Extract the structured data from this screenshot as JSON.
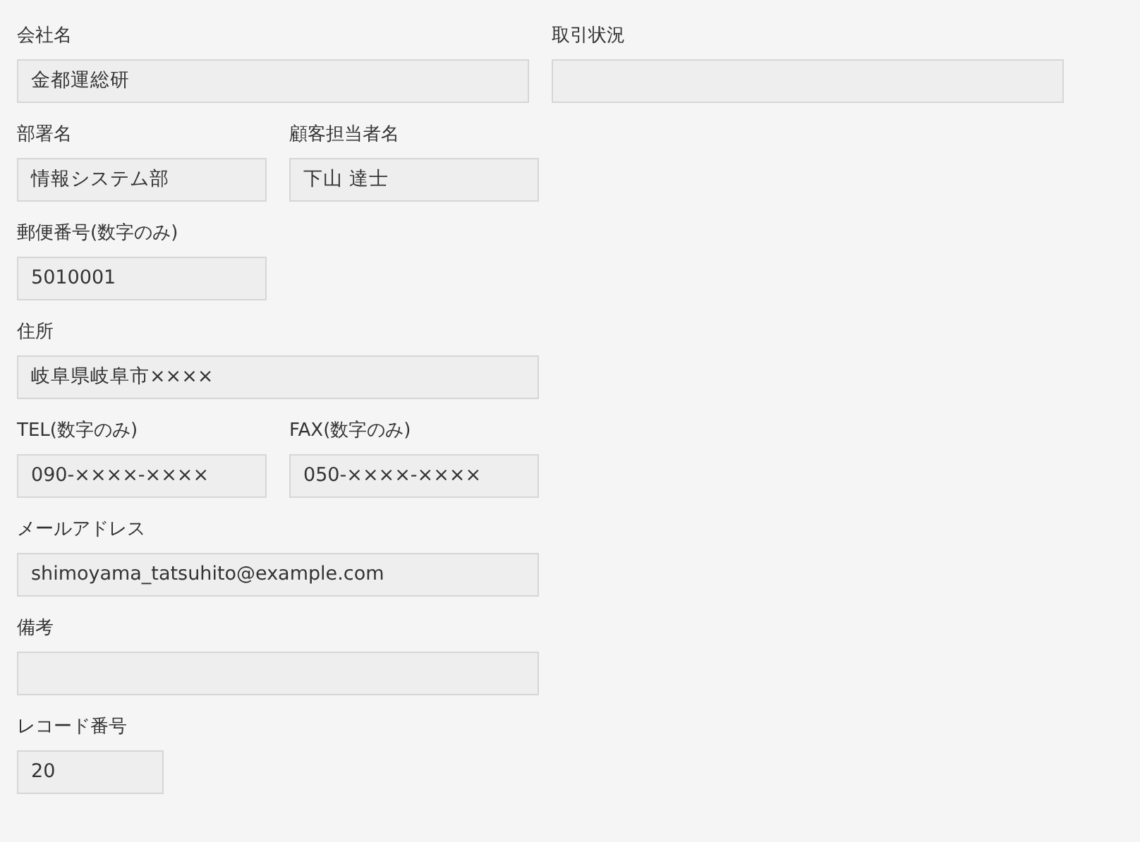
{
  "rows": [
    [
      {
        "label": "会社名",
        "value": "金都運総研",
        "kind": "wide"
      },
      {
        "label": "取引状況",
        "kind": "wide"
      }
    ],
    [
      {
        "label": "部署名",
        "value": "情報システム部",
        "kind": "half"
      },
      {
        "label": "顧客担当者名",
        "value": "下山 達士",
        "kind": "half"
      }
    ],
    [
      {
        "label": "郵便番号(数字のみ)",
        "value": "5010001",
        "kind": "half"
      }
    ],
    [
      {
        "label": "住所",
        "value": "岐阜県岐阜市××××",
        "kind": "full"
      }
    ],
    [
      {
        "label": "TEL(数字のみ)",
        "value": "090-××××-××××",
        "kind": "half"
      },
      {
        "label": "FAX(数字のみ)",
        "value": "050-××××-××××",
        "kind": "half"
      }
    ],
    [
      {
        "label": "メールアドレス",
        "value": "shimoyama_tatsuhito@example.com",
        "kind": "full"
      }
    ],
    [
      {
        "label": "備考",
        "kind": "full"
      }
    ],
    [
      {
        "label": "レコード番号",
        "value": "20",
        "kind": "tiny"
      }
    ]
  ]
}
